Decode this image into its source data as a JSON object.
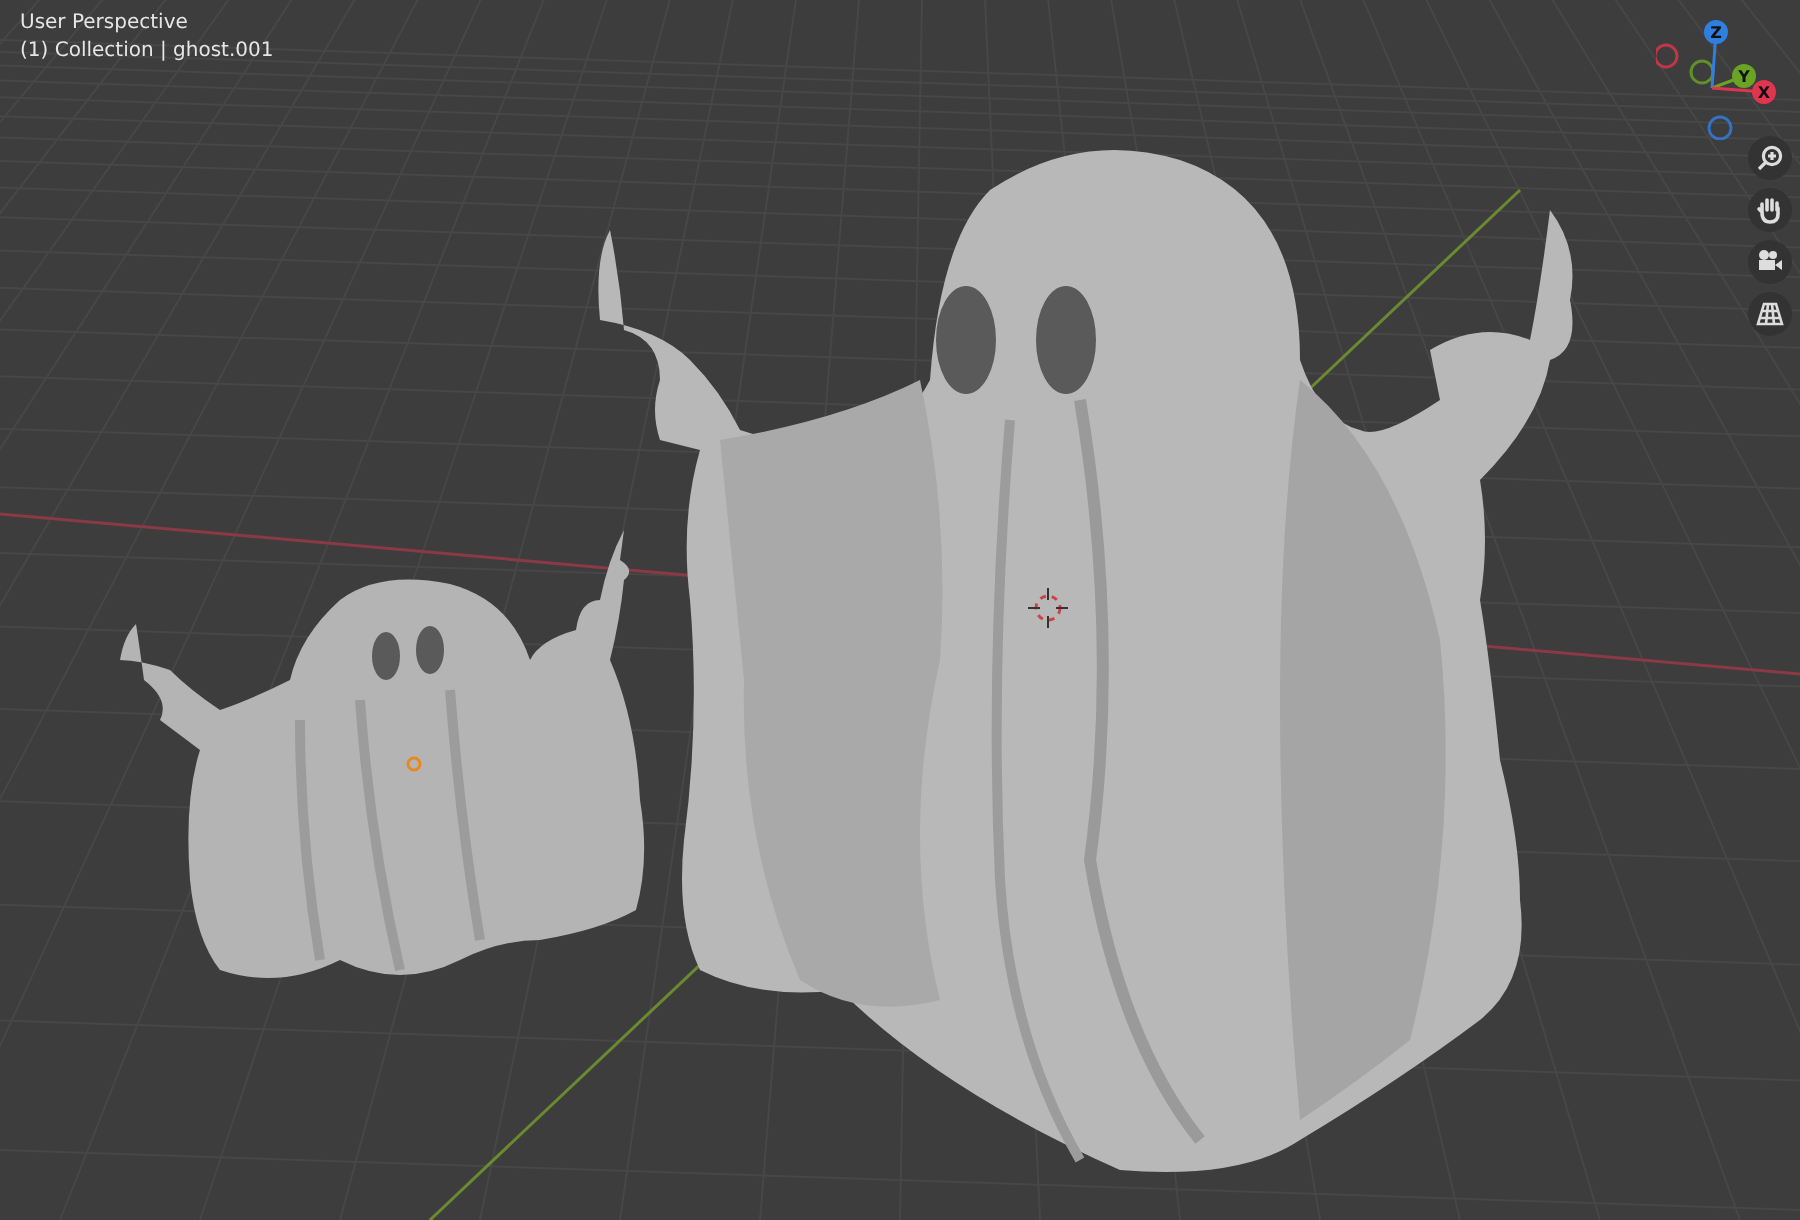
{
  "viewport": {
    "view_name": "User Perspective",
    "object_info": "(1) Collection | ghost.001"
  },
  "gizmo": {
    "axes": [
      {
        "label": "Z",
        "color": "#2f7fe0"
      },
      {
        "label": "Y",
        "color": "#6aa424"
      },
      {
        "label": "X",
        "color": "#e0354f"
      }
    ]
  },
  "tools": [
    {
      "kind": "zoom"
    },
    {
      "kind": "pan"
    },
    {
      "kind": "camera"
    },
    {
      "kind": "ortho"
    }
  ]
}
